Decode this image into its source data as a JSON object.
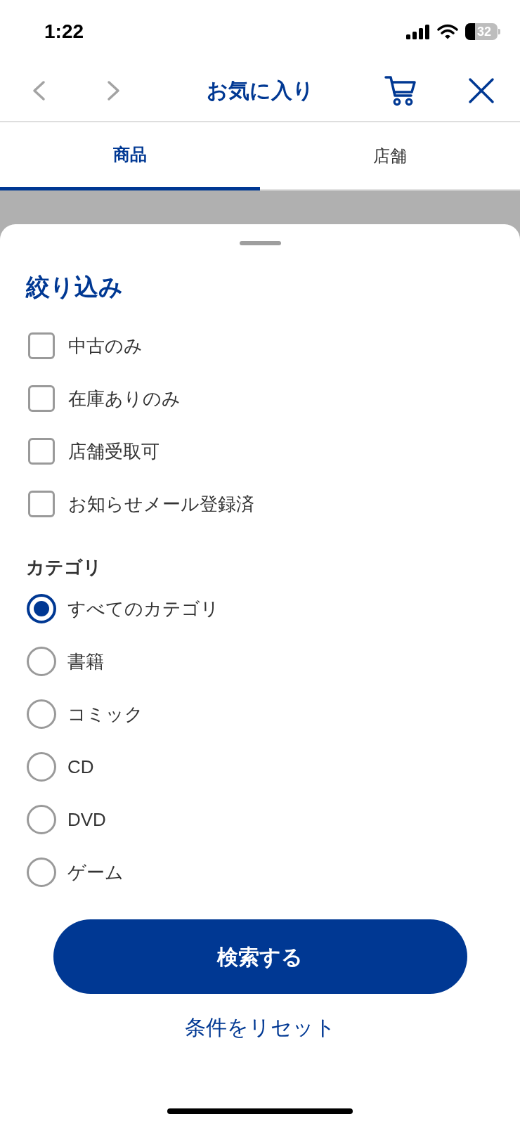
{
  "status_bar": {
    "time": "1:22",
    "battery": "32"
  },
  "nav_bar": {
    "title": "お気に入り",
    "nav_buttons": [
      {
        "kind": "back",
        "disabled": true
      },
      {
        "kind": "forward",
        "disabled": true
      }
    ]
  },
  "tabs": [
    {
      "label": "商品",
      "selected": true
    },
    {
      "label": "店舗",
      "selected": false
    }
  ],
  "filter_sheet": {
    "title": "絞り込み",
    "checkboxes": [
      {
        "label": "中古のみ",
        "checked": false
      },
      {
        "label": "在庫ありのみ",
        "checked": false
      },
      {
        "label": "店舗受取可",
        "checked": false
      },
      {
        "label": "お知らせメール登録済",
        "checked": false
      }
    ],
    "category": {
      "label": "カテゴリ",
      "options": [
        {
          "label": "すべてのカテゴリ",
          "selected": true
        },
        {
          "label": "書籍",
          "selected": false
        },
        {
          "label": "コミック",
          "selected": false
        },
        {
          "label": "CD",
          "selected": false
        },
        {
          "label": "DVD",
          "selected": false
        },
        {
          "label": "ゲーム",
          "selected": false
        }
      ]
    },
    "search_button": "検索する",
    "reset_link": "条件をリセット"
  }
}
